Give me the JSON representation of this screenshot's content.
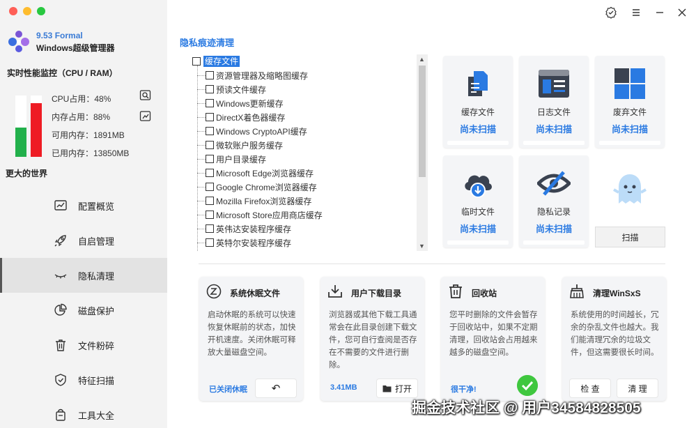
{
  "app": {
    "version": "9.53 Formal",
    "name": "Windows超级管理器"
  },
  "monitor": {
    "title": "实时性能监控（CPU / RAM）",
    "cpu_usage": "CPU占用：48%",
    "mem_usage": "内存占用：88%",
    "available_mem": "可用内存：1891MB",
    "used_mem": "已用内存：13850MB",
    "cpu_level": 0.48,
    "mem_level": 0.88,
    "cpu_color": "#22b04b",
    "mem_color": "#ee1c24"
  },
  "slogan": "更大的世界",
  "nav": [
    {
      "label": "配置概览",
      "icon": "chart-icon"
    },
    {
      "label": "自启管理",
      "icon": "rocket-icon"
    },
    {
      "label": "隐私清理",
      "icon": "eye-closed-icon",
      "active": true
    },
    {
      "label": "磁盘保护",
      "icon": "pie-chart-icon"
    },
    {
      "label": "文件粉碎",
      "icon": "trash-icon"
    },
    {
      "label": "特征扫描",
      "icon": "shield-icon"
    },
    {
      "label": "工具大全",
      "icon": "bag-icon"
    }
  ],
  "main": {
    "section_title": "隐私痕迹清理",
    "tree_root": "缓存文件",
    "tree_items": [
      "资源管理器及缩略图缓存",
      "预读文件缓存",
      "Windows更新缓存",
      "DirectX着色器缓存",
      "Windows CryptoAPI缓存",
      "微软账户服务缓存",
      "用户目录缓存",
      "Microsoft Edge浏览器缓存",
      "Google Chrome浏览器缓存",
      "Mozilla Firefox浏览器缓存",
      "Microsoft Store应用商店缓存",
      "英伟达安装程序缓存",
      "英特尔安装程序缓存"
    ],
    "cards": [
      {
        "label": "缓存文件",
        "status": "尚未扫描",
        "icon": "document-icon"
      },
      {
        "label": "日志文件",
        "status": "尚未扫描",
        "icon": "log-window-icon"
      },
      {
        "label": "废弃文件",
        "status": "尚未扫描",
        "icon": "windows-tiles-icon"
      },
      {
        "label": "临时文件",
        "status": "尚未扫描",
        "icon": "cloud-download-icon"
      },
      {
        "label": "隐私记录",
        "status": "尚未扫描",
        "icon": "eye-slash-icon"
      }
    ],
    "scan_label": "扫描",
    "panels": [
      {
        "title": "系统休眠文件",
        "icon": "sleep-icon",
        "desc": "启动休眠的系统可以快速恢复休眠前的状态，加快开机速度。关闭休眠可释放大量磁盘空间。",
        "note": "已关闭休眠",
        "button": "↶"
      },
      {
        "title": "用户下载目录",
        "icon": "download-tray-icon",
        "desc": "浏览器或其他下载工具通常会在此目录创建下载文件，您可自行查阅是否存在不需要的文件进行删除。",
        "note": "3.41MB",
        "button": "打开"
      },
      {
        "title": "回收站",
        "icon": "recycle-bin-icon",
        "desc": "您平时删除的文件会暂存于回收站中，如果不定期清理，回收站会占用越来越多的磁盘空间。",
        "note": "很干净!"
      },
      {
        "title": "清理WinSxS",
        "icon": "winsxs-broom-icon",
        "desc": "系统使用的时间越长，冗余的杂乱文件也越大。我们能清理冗余的垃圾文件，但这需要很长时间。",
        "button_check": "检 查",
        "button_clean": "清 理"
      }
    ]
  },
  "watermark": "掘金技术社区 @ 用户34584828505"
}
